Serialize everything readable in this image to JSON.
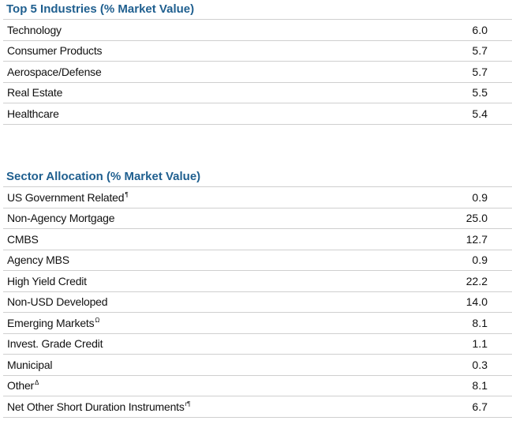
{
  "top_industries": {
    "title": "Top 5 Industries (% Market Value)",
    "rows": [
      {
        "label": "Technology",
        "value": "6.0"
      },
      {
        "label": "Consumer Products",
        "value": "5.7"
      },
      {
        "label": "Aerospace/Defense",
        "value": "5.7"
      },
      {
        "label": "Real Estate",
        "value": "5.5"
      },
      {
        "label": "Healthcare",
        "value": "5.4"
      }
    ]
  },
  "sector_allocation": {
    "title": "Sector Allocation (% Market Value)",
    "rows": [
      {
        "label": "US Government Related",
        "note": "¶",
        "value": "0.9"
      },
      {
        "label": "Non-Agency Mortgage",
        "note": "",
        "value": "25.0"
      },
      {
        "label": "CMBS",
        "note": "",
        "value": "12.7"
      },
      {
        "label": "Agency MBS",
        "note": "",
        "value": "0.9"
      },
      {
        "label": "High Yield Credit",
        "note": "",
        "value": "22.2"
      },
      {
        "label": "Non-USD Developed",
        "note": "",
        "value": "14.0"
      },
      {
        "label": "Emerging Markets",
        "note": "Ω",
        "value": "8.1"
      },
      {
        "label": "Invest. Grade Credit",
        "note": "",
        "value": "1.1"
      },
      {
        "label": "Municipal",
        "note": "",
        "value": "0.3"
      },
      {
        "label": "Other",
        "note": "Δ",
        "value": "8.1"
      },
      {
        "label": "Net Other Short Duration Instruments",
        "note": "r¶",
        "value": "6.7"
      }
    ]
  }
}
